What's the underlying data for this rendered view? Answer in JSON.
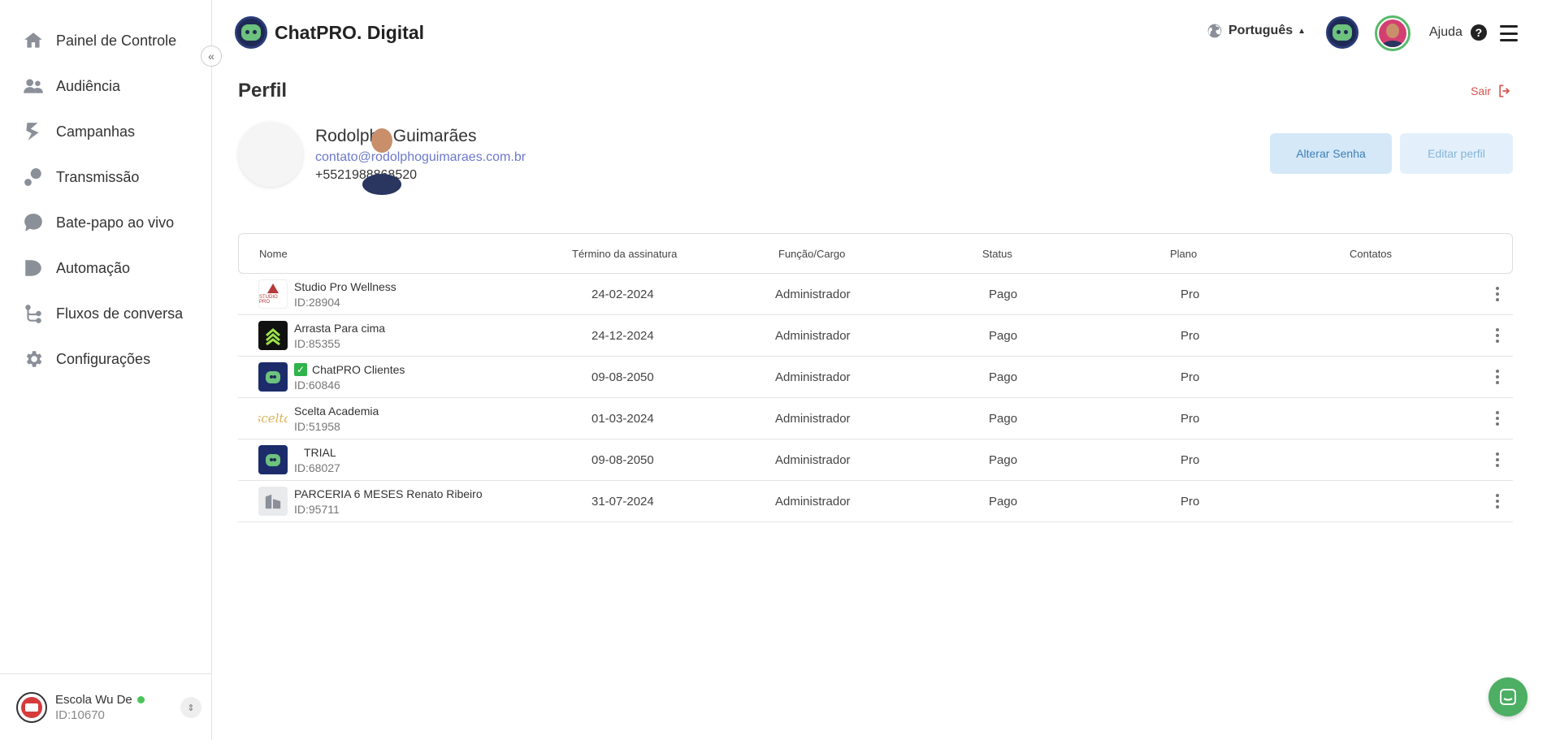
{
  "sidebar": {
    "items": [
      {
        "label": "Painel de Controle",
        "icon": "home-icon"
      },
      {
        "label": "Audiência",
        "icon": "users-icon"
      },
      {
        "label": "Campanhas",
        "icon": "campaign-icon"
      },
      {
        "label": "Transmissão",
        "icon": "broadcast-icon"
      },
      {
        "label": "Bate-papo ao vivo",
        "icon": "chat-bubble-icon"
      },
      {
        "label": "Automação",
        "icon": "automation-icon"
      },
      {
        "label": "Fluxos de conversa",
        "icon": "flow-icon"
      },
      {
        "label": "Configurações",
        "icon": "gear-icon"
      }
    ],
    "collapse_label": "«",
    "footer": {
      "org_name": "Escola Wu De",
      "org_id": "ID:10670",
      "status_color": "#4cc35a"
    }
  },
  "header": {
    "brand": "ChatPRO. Digital",
    "language": "Português",
    "help": "Ajuda"
  },
  "page": {
    "title": "Perfil",
    "logout": "Sair",
    "profile": {
      "name": "Rodolpho Guimarães",
      "email": "contato@rodolphoguimaraes.com.br",
      "phone": "+5521988868520"
    },
    "buttons": {
      "change_password": "Alterar Senha",
      "edit_profile": "Editar perfil"
    }
  },
  "table": {
    "columns": [
      "Nome",
      "Término da assinatura",
      "Função/Cargo",
      "Status",
      "Plano",
      "Contatos"
    ],
    "rows": [
      {
        "name": "Studio Pro Wellness",
        "id": "ID:28904",
        "end": "24-02-2024",
        "role": "Administrador",
        "status": "Pago",
        "plan": "Pro",
        "logo": "studio-pro-logo"
      },
      {
        "name": "Arrasta Para cima",
        "id": "ID:85355",
        "end": "24-12-2024",
        "role": "Administrador",
        "status": "Pago",
        "plan": "Pro",
        "logo": "arrasta-logo"
      },
      {
        "name": "ChatPRO Clientes",
        "id": "ID:60846",
        "end": "09-08-2050",
        "role": "Administrador",
        "status": "Pago",
        "plan": "Pro",
        "logo": "chatpro-logo"
      },
      {
        "name": "Scelta Academia",
        "id": "ID:51958",
        "end": "01-03-2024",
        "role": "Administrador",
        "status": "Pago",
        "plan": "Pro",
        "logo": "scelta-logo"
      },
      {
        "name": "TRIAL",
        "id": "ID:68027",
        "end": "09-08-2050",
        "role": "Administrador",
        "status": "Pago",
        "plan": "Pro",
        "logo": "chatpro-logo"
      },
      {
        "name": "PARCERIA 6 MESES Renato Ribeiro",
        "id": "ID:95711",
        "end": "31-07-2024",
        "role": "Administrador",
        "status": "Pago",
        "plan": "Pro",
        "logo": "building-logo"
      }
    ],
    "logo_texts": {
      "studio": "STUDIO PRO",
      "scelta": "scelta"
    }
  },
  "colors": {
    "accent": "#4caf63",
    "link": "#6c78c9",
    "logout": "#d9534f",
    "brand_dark": "#1e2a55"
  }
}
